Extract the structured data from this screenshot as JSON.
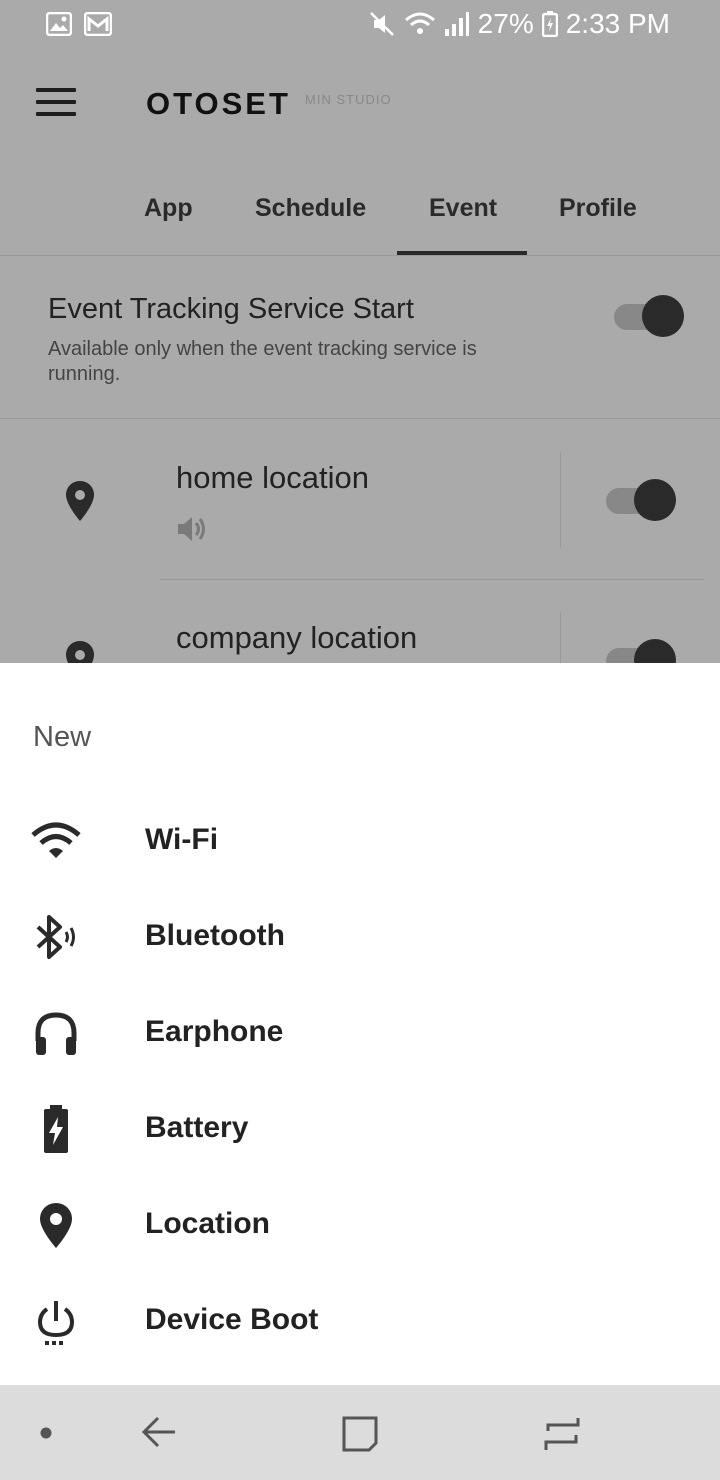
{
  "status_bar": {
    "battery": "27%",
    "time": "2:33 PM"
  },
  "header": {
    "brand": "OTOSET",
    "brand_sub": "MIN STUDIO"
  },
  "tabs": [
    {
      "label": "App"
    },
    {
      "label": "Schedule"
    },
    {
      "label": "Event",
      "active": true
    },
    {
      "label": "Profile"
    }
  ],
  "service": {
    "title": "Event Tracking Service Start",
    "description": "Available only when the event tracking service is running.",
    "enabled": true
  },
  "events": [
    {
      "name": "home location",
      "icon": "location-pin-icon",
      "sound_icon": "volume-icon",
      "enabled": true
    },
    {
      "name": "company location",
      "icon": "location-pin-icon",
      "enabled": true
    }
  ],
  "sheet": {
    "title": "New",
    "items": [
      {
        "label": "Wi-Fi",
        "icon": "wifi-icon"
      },
      {
        "label": "Bluetooth",
        "icon": "bluetooth-icon"
      },
      {
        "label": "Earphone",
        "icon": "headphones-icon"
      },
      {
        "label": "Battery",
        "icon": "battery-charging-icon"
      },
      {
        "label": "Location",
        "icon": "location-pin-icon"
      },
      {
        "label": "Device Boot",
        "icon": "power-icon"
      }
    ]
  },
  "colors": {
    "scrim_background": "#aaaaaa",
    "sheet_background": "#ffffff",
    "text_primary": "#222222",
    "navbar_background": "#dcdcdc"
  }
}
